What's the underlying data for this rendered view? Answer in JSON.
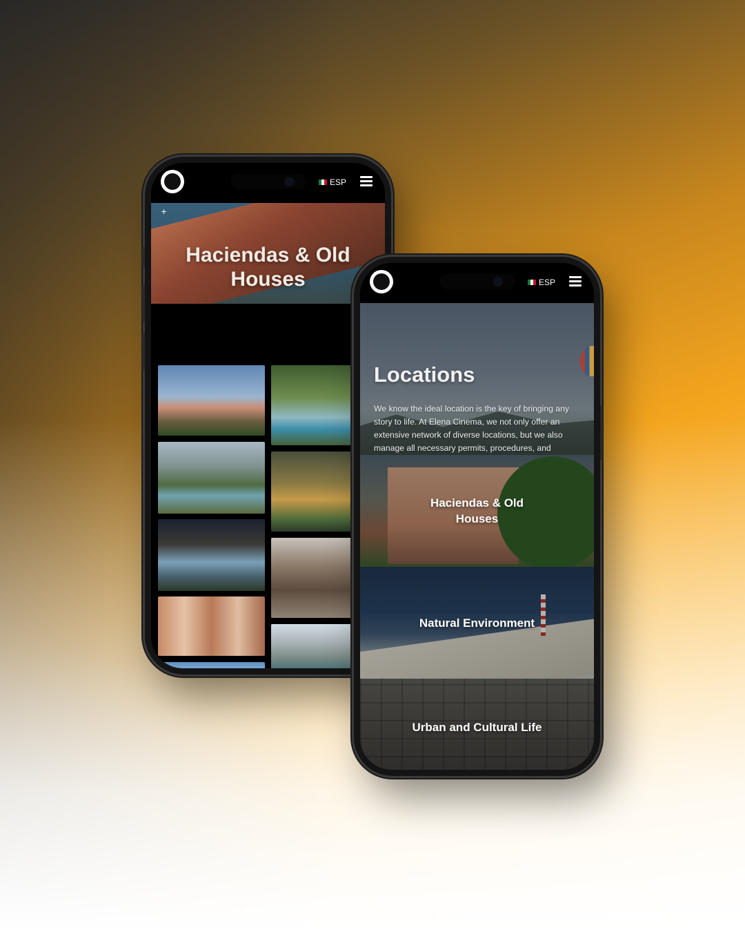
{
  "colors": {
    "accent": "#f4a51e",
    "screen_bg": "#000000",
    "text_light": "#ffffff"
  },
  "phone1": {
    "header": {
      "logo_icon": "elena-cinema-logo",
      "language_label": "ESP",
      "language_flag": "mexico-flag-icon",
      "menu_icon": "hamburger-menu-icon"
    },
    "hero": {
      "expand_symbol": "+",
      "title": "Haciendas & Old Houses"
    },
    "gallery": {
      "images": [
        "hacienda-with-volcano",
        "garden-fountain-channel",
        "canyon-pool",
        "orchard-garden-sunset",
        "night-pool-house",
        "ruined-hacienda-arches",
        "colonial-courtyard-arches",
        "modern-stone-patio",
        "blue-sky-partial"
      ]
    }
  },
  "phone2": {
    "header": {
      "logo_icon": "elena-cinema-logo",
      "language_label": "ESP",
      "language_flag": "mexico-flag-icon",
      "menu_icon": "hamburger-menu-icon"
    },
    "hero": {
      "title": "Locations",
      "description": "We know the ideal location is the key of bringing any story to life. At Elena Cinema, we not only offer an extensive network of diverse locations, but we also manage all necessary permits, procedures, and contracts to secure the perfect spot that elevates your project's visual narrative"
    },
    "categories": [
      {
        "label": "Haciendas & Old Houses"
      },
      {
        "label": "Natural Environment"
      },
      {
        "label": "Urban and Cultural Life"
      }
    ]
  }
}
